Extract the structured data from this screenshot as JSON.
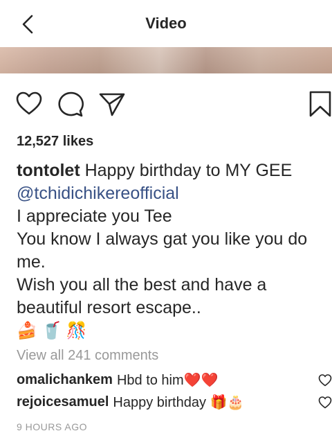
{
  "header": {
    "title": "Video",
    "back_icon": "chevron-left-icon"
  },
  "actions": {
    "like_icon": "heart-outline-icon",
    "comment_icon": "comment-bubble-icon",
    "share_icon": "paper-plane-icon",
    "save_icon": "bookmark-icon"
  },
  "post": {
    "likes": "12,527 likes",
    "caption": {
      "username": "tontolet",
      "line1_text": "Happy birthday to MY GEE",
      "mention": "@tchidichikereofficial",
      "line3": "I appreciate you Tee",
      "line4": "You know I always gat you like you do",
      "line5": "me.",
      "line6": "Wish you all the best and have a",
      "line7": "beautiful resort escape..",
      "emojis": [
        "🍰",
        "🥤",
        "🎊"
      ]
    },
    "view_all_comments": "View all 241 comments",
    "comments": [
      {
        "username": "omalichankem",
        "text": "Hbd to him❤️❤️"
      },
      {
        "username": "rejoicesamuel",
        "text": "Happy birthday 🎁🎂"
      }
    ],
    "timestamp": "9 HOURS AGO"
  },
  "colors": {
    "text": "#262626",
    "mention": "#385185",
    "muted": "#999999",
    "background": "#ffffff"
  }
}
